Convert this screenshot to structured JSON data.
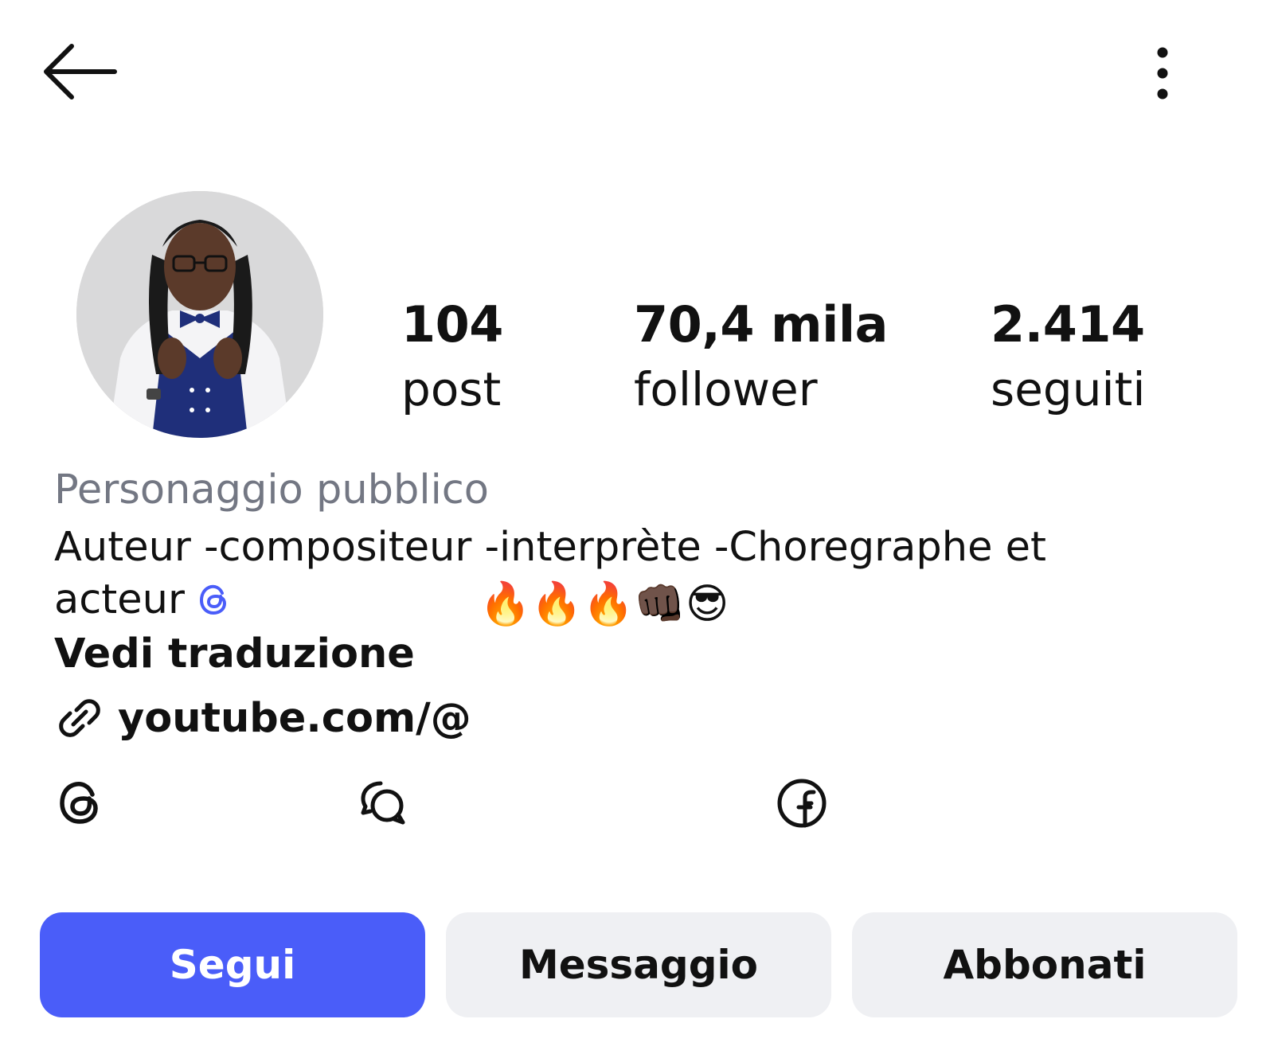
{
  "header": {
    "back_icon": "arrow-left-icon",
    "menu_icon": "more-vertical-icon"
  },
  "profile": {
    "avatar": "profile-photo"
  },
  "stats": [
    {
      "value": "104",
      "label": "post"
    },
    {
      "value": "70,4 mila",
      "label": "follower"
    },
    {
      "value": "2.414",
      "label": "seguiti"
    }
  ],
  "bio": {
    "category": "Personaggio pubblico",
    "line1": "Auteur -compositeur -interprète -Choregraphe et",
    "line2": "acteur",
    "emojis": "🔥🔥🔥👊🏿😎",
    "translate_label": "Vedi traduzione",
    "link_text": "youtube.com/@",
    "threads_color": "#4a5df9"
  },
  "social_links": [
    {
      "icon": "threads-icon"
    },
    {
      "icon": "messenger-chat-icon"
    },
    {
      "icon": "facebook-icon"
    }
  ],
  "actions": {
    "follow_label": "Segui",
    "message_label": "Messaggio",
    "subscribe_label": "Abbonati"
  },
  "colors": {
    "accent": "#4a5df9",
    "secondary_button": "#eff0f3",
    "muted_text": "#737783"
  }
}
